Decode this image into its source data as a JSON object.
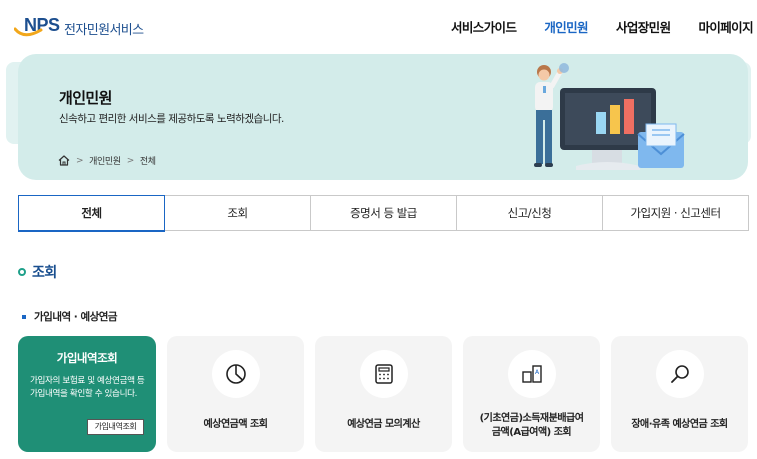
{
  "header": {
    "logo_mark": "NPS",
    "logo_text": "전자민원서비스",
    "nav": [
      {
        "label": "서비스가이드",
        "active": false
      },
      {
        "label": "개인민원",
        "active": true
      },
      {
        "label": "사업장민원",
        "active": false
      },
      {
        "label": "마이페이지",
        "active": false
      }
    ]
  },
  "banner": {
    "title": "개인민원",
    "subtitle": "신속하고 편리한 서비스를 제공하도록 노력하겠습니다.",
    "breadcrumb": [
      "개인민원",
      "전체"
    ]
  },
  "tabs": [
    {
      "label": "전체",
      "active": true
    },
    {
      "label": "조회",
      "active": false
    },
    {
      "label": "증명서 등 발급",
      "active": false
    },
    {
      "label": "신고/신청",
      "active": false
    },
    {
      "label": "가입지원 · 신고센터",
      "active": false
    }
  ],
  "section": {
    "title": "조회",
    "subtitle": "가입내역 · 예상연금"
  },
  "cards": {
    "feature": {
      "title": "가입내역조회",
      "description": "가입자의 보험료 및 예상연금액 등 가입내역을 확인할 수 있습니다.",
      "button": "가입내역조회"
    },
    "items": [
      {
        "label": "예상연금액 조회",
        "icon": "pie-chart-icon"
      },
      {
        "label": "예상연금 모의계산",
        "icon": "calculator-icon"
      },
      {
        "label_line1": "(기초연금)소득재분배급여",
        "label_line2": "금액(A급여액) 조회",
        "icon": "document-compare-icon"
      },
      {
        "label": "장애·유족 예상연금 조회",
        "icon": "magnifier-icon"
      }
    ]
  },
  "colors": {
    "brand_blue": "#1d4f8f",
    "active_blue": "#1a66c4",
    "banner": "#d3ecea",
    "feature_green": "#1f8f76"
  }
}
